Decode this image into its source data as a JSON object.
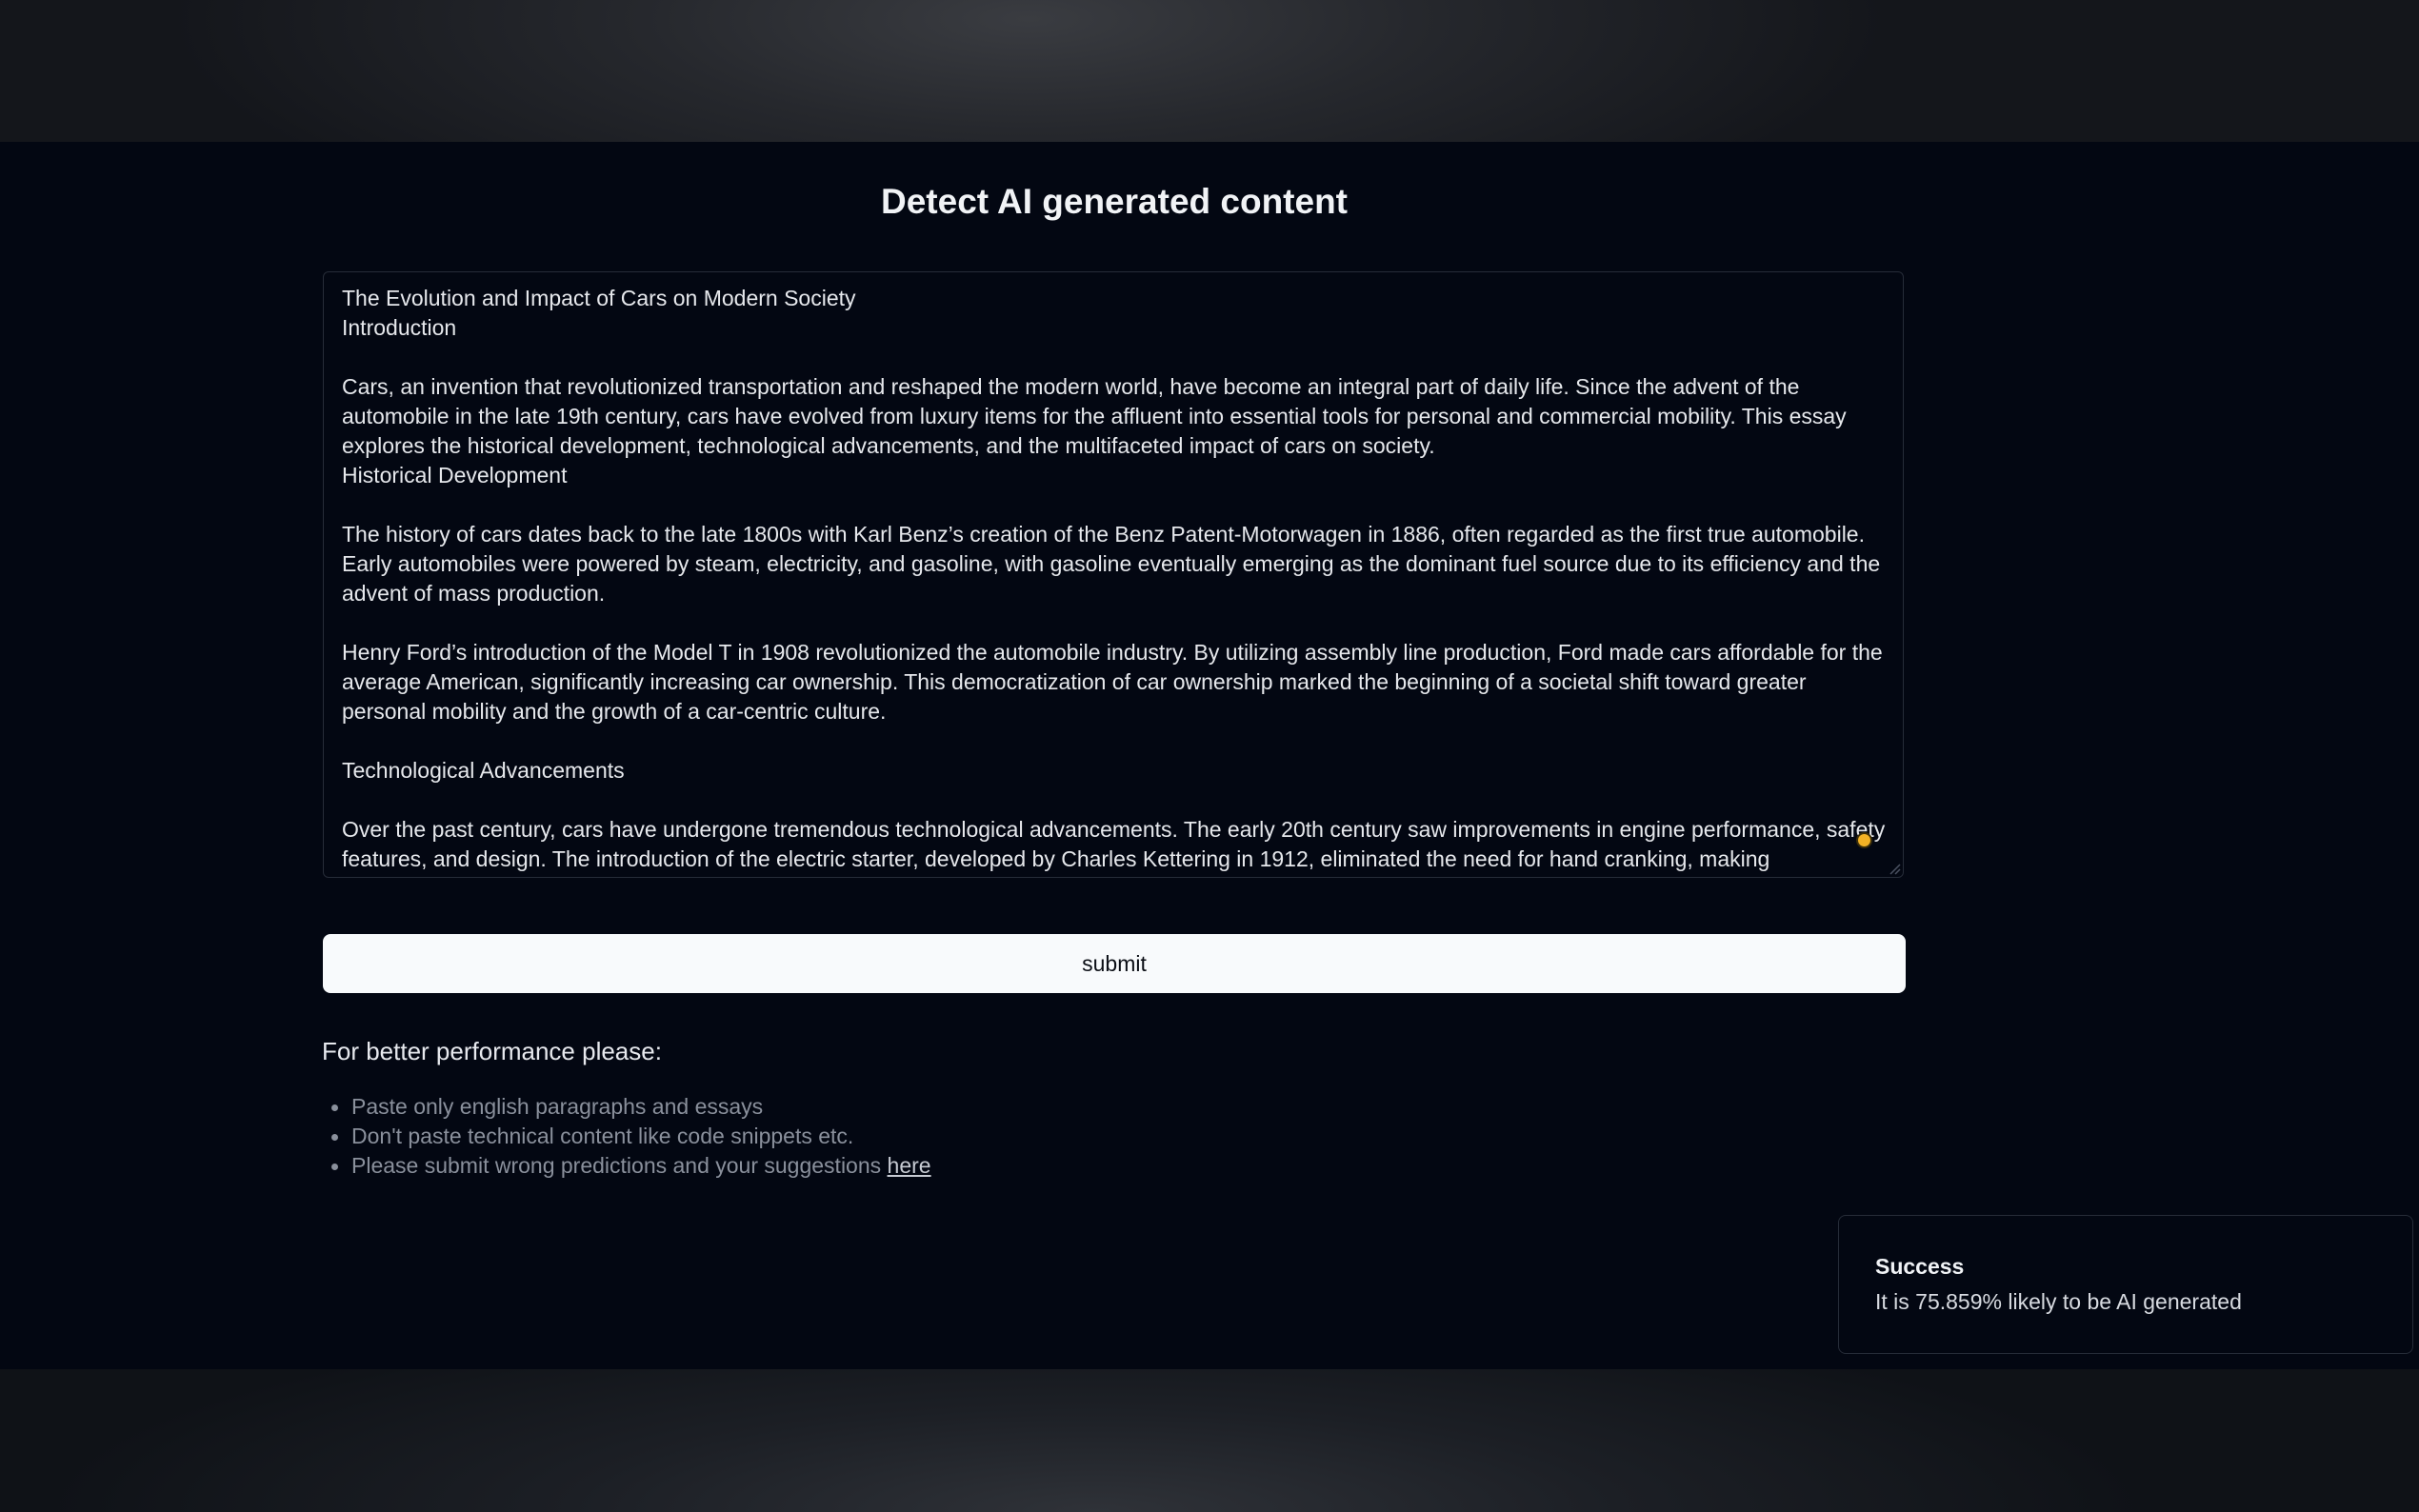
{
  "page": {
    "title": "Detect AI generated content"
  },
  "editor": {
    "text": "The Evolution and Impact of Cars on Modern Society\nIntroduction\n\nCars, an invention that revolutionized transportation and reshaped the modern world, have become an integral part of daily life. Since the advent of the automobile in the late 19th century, cars have evolved from luxury items for the affluent into essential tools for personal and commercial mobility. This essay explores the historical development, technological advancements, and the multifaceted impact of cars on society.\nHistorical Development\n\nThe history of cars dates back to the late 1800s with Karl Benz’s creation of the Benz Patent-Motorwagen in 1886, often regarded as the first true automobile. Early automobiles were powered by steam, electricity, and gasoline, with gasoline eventually emerging as the dominant fuel source due to its efficiency and the advent of mass production.\n\nHenry Ford’s introduction of the Model T in 1908 revolutionized the automobile industry. By utilizing assembly line production, Ford made cars affordable for the average American, significantly increasing car ownership. This democratization of car ownership marked the beginning of a societal shift toward greater personal mobility and the growth of a car-centric culture.\n\nTechnological Advancements\n\nOver the past century, cars have undergone tremendous technological advancements. The early 20th century saw improvements in engine performance, safety features, and design. The introduction of the electric starter, developed by Charles Kettering in 1912, eliminated the need for hand cranking, making"
  },
  "submit": {
    "label": "submit"
  },
  "tips": {
    "heading": "For better performance please:",
    "items": [
      "Paste only english paragraphs and essays",
      "Don't paste technical content like code snippets etc.",
      "Please submit wrong predictions and your suggestions "
    ],
    "link_label": "here"
  },
  "toast": {
    "title": "Success",
    "message": "It is 75.859% likely to be AI generated"
  },
  "colors": {
    "background": "#030712",
    "button": "#f8fafc",
    "indicator": "#f3b225"
  }
}
